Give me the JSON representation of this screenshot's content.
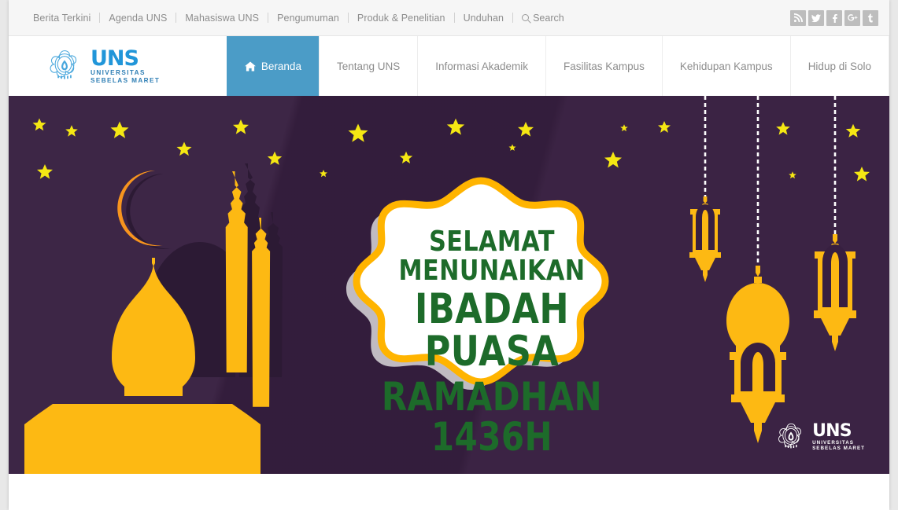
{
  "topbar": {
    "links": [
      {
        "label": "Berita Terkini"
      },
      {
        "label": "Agenda UNS"
      },
      {
        "label": "Mahasiswa UNS"
      },
      {
        "label": "Pengumuman"
      },
      {
        "label": "Produk & Penelitian"
      },
      {
        "label": "Unduhan"
      }
    ],
    "search_label": "Search",
    "search_icon": "search-icon",
    "socials": [
      {
        "name": "rss-icon",
        "glyph": "≈"
      },
      {
        "name": "twitter-icon",
        "glyph": "t"
      },
      {
        "name": "facebook-icon",
        "glyph": "f"
      },
      {
        "name": "google-plus-icon",
        "glyph": "g+"
      },
      {
        "name": "tumblr-icon",
        "glyph": "t"
      }
    ]
  },
  "logo": {
    "name": "UNS",
    "line1": "UNIVERSITAS",
    "line2": "SEBELAS MARET",
    "color": "#2196d9"
  },
  "nav": {
    "items": [
      {
        "label": "Beranda",
        "active": true,
        "icon": "home-icon"
      },
      {
        "label": "Tentang UNS",
        "active": false
      },
      {
        "label": "Informasi Akademik",
        "active": false
      },
      {
        "label": "Fasilitas Kampus",
        "active": false
      },
      {
        "label": "Kehidupan Kampus",
        "active": false
      },
      {
        "label": "Hidup di Solo",
        "active": false
      }
    ],
    "active_bg": "#4b9cc7"
  },
  "banner": {
    "alt": "ramadhan-greeting-banner",
    "line1": "SELAMAT MENUNAIKAN",
    "line2": "IBADAH PUASA",
    "line3": "RAMADHAN 1436H",
    "text_color": "#1d6b2a",
    "background_color": "#371f40",
    "accent_gold": "#fdb913",
    "accent_orange": "#f7941e",
    "star_color": "#f5e713",
    "plaque_border": "#ffb400",
    "logo": {
      "name": "UNS",
      "line1": "UNIVERSITAS",
      "line2": "SEBELAS MARET"
    }
  }
}
